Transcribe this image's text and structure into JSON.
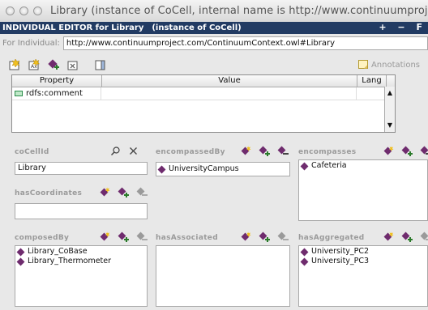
{
  "window": {
    "title": "Library   (instance of CoCell, internal name is http://www.continuumproject.co..."
  },
  "header": {
    "editor_label": "INDIVIDUAL EDITOR for Library",
    "instance_label": "(instance of CoCell)",
    "controls": "+ − F"
  },
  "individual": {
    "label": "For Individual:",
    "value": "http://www.continuumproject.com/ContinuumContext.owl#Library"
  },
  "toolbar": {
    "annotations_label": "Annotations"
  },
  "property_table": {
    "headers": [
      "Property",
      "Value",
      "Lang"
    ],
    "rows": [
      {
        "property": "rdfs:comment",
        "value": "",
        "lang": ""
      }
    ]
  },
  "panels": {
    "coCellId": {
      "title": "coCellId",
      "value": "Library"
    },
    "encompassedBy": {
      "title": "encompassedBy",
      "items": [
        "UniversityCampus"
      ]
    },
    "encompasses": {
      "title": "encompasses",
      "items": [
        "Cafeteria"
      ]
    },
    "hasCoordinates": {
      "title": "hasCoordinates",
      "value": ""
    },
    "composedBy": {
      "title": "composedBy",
      "items": [
        "Library_CoBase",
        "Library_Thermometer"
      ]
    },
    "hasAssociated": {
      "title": "hasAssociated",
      "items": []
    },
    "hasAggregated": {
      "title": "hasAggregated",
      "items": [
        "University_PC2",
        "University_PC3"
      ]
    }
  },
  "colors": {
    "header_bg": "#223b63",
    "instance_diamond": "#6f2c6e",
    "panel_title": "#9a9a9a"
  }
}
